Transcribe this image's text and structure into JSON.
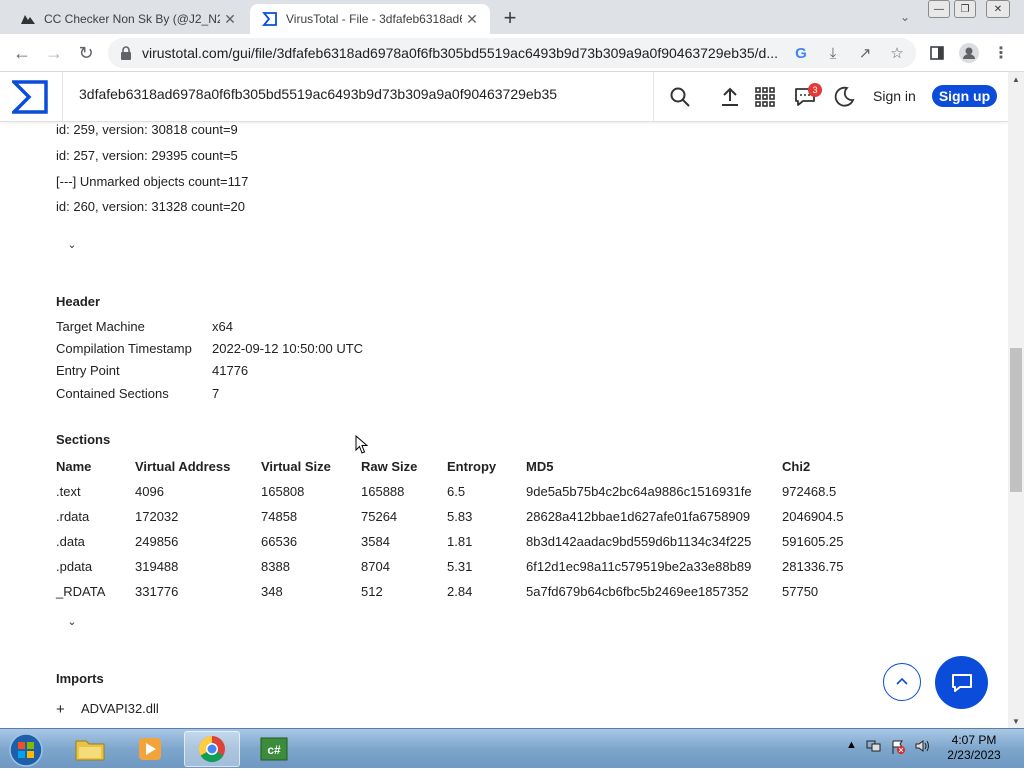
{
  "browser": {
    "tabs": [
      {
        "title": "CC Checker Non Sk By (@J2_N2)",
        "active": false
      },
      {
        "title": "VirusTotal - File - 3dfafeb6318ad6978a0f6fb305bd5519ac6493b9d73b309a9a0f90463729eb35",
        "active": true
      }
    ],
    "url": "virustotal.com/gui/file/3dfafeb6318ad6978a0f6fb305bd5519ac6493b9d73b309a9a0f90463729eb35/d..."
  },
  "vt": {
    "search_value": "3dfafeb6318ad6978a0f6fb305bd5519ac6493b9d73b309a9a0f90463729eb35",
    "notif_count": "3",
    "signin": "Sign in",
    "signup": "Sign up",
    "accent": "#0b4dda"
  },
  "rich_header": [
    "id: 259, version: 30818 count=9",
    "id: 257, version: 29395 count=5",
    "[---] Unmarked objects count=117",
    "id: 260, version: 31328 count=20"
  ],
  "header": {
    "title": "Header",
    "rows": [
      {
        "label": "Target Machine",
        "value": "x64"
      },
      {
        "label": "Compilation Timestamp",
        "value": "2022-09-12 10:50:00 UTC"
      },
      {
        "label": "Entry Point",
        "value": "41776"
      },
      {
        "label": "Contained Sections",
        "value": "7"
      }
    ]
  },
  "sections": {
    "title": "Sections",
    "columns": [
      "Name",
      "Virtual Address",
      "Virtual Size",
      "Raw Size",
      "Entropy",
      "MD5",
      "Chi2"
    ],
    "rows": [
      [
        ".text",
        "4096",
        "165808",
        "165888",
        "6.5",
        "9de5a5b75b4c2bc64a9886c1516931fe",
        "972468.5"
      ],
      [
        ".rdata",
        "172032",
        "74858",
        "75264",
        "5.83",
        "28628a412bbae1d627afe01fa6758909",
        "2046904.5"
      ],
      [
        ".data",
        "249856",
        "66536",
        "3584",
        "1.81",
        "8b3d142aadac9bd559d6b1134c34f225",
        "591605.25"
      ],
      [
        ".pdata",
        "319488",
        "8388",
        "8704",
        "5.31",
        "6f12d1ec98a11c579519be2a33e88b89",
        "281336.75"
      ],
      [
        "_RDATA",
        "331776",
        "348",
        "512",
        "2.84",
        "5a7fd679b64cb6fbc5b2469ee1857352",
        "57750"
      ]
    ]
  },
  "imports": {
    "title": "Imports",
    "items": [
      {
        "label": "ADVAPI32.dll"
      }
    ]
  },
  "taskbar": {
    "clock_time": "4:07 PM",
    "clock_date": "2/23/2023"
  }
}
